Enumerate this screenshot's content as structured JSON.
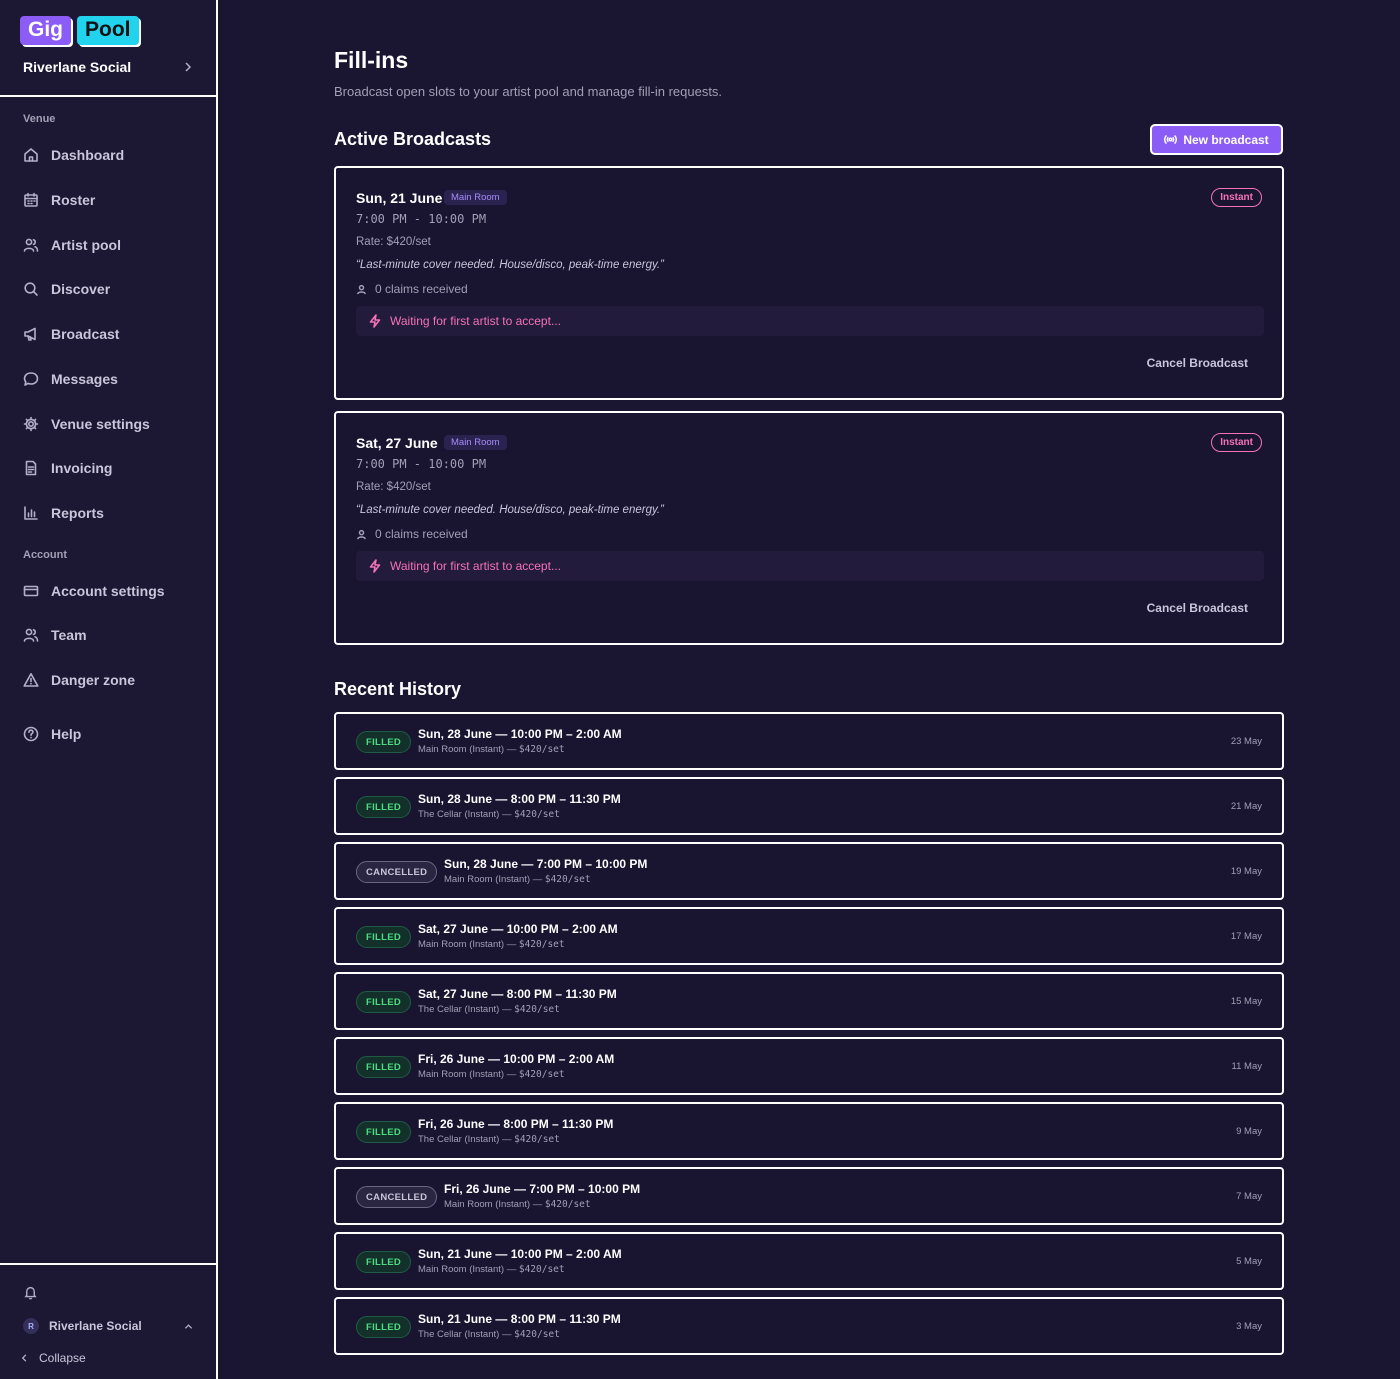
{
  "brand": {
    "part1": "Gig",
    "part2": "Pool",
    "accent": "#8b5cf6",
    "accent2": "#22d3ee"
  },
  "sidebar": {
    "venue_name": "Riverlane Social",
    "sections": [
      {
        "label": "Venue"
      },
      {
        "label": "Account"
      }
    ],
    "items": [
      {
        "label": "Dashboard",
        "icon": "home-icon"
      },
      {
        "label": "Roster",
        "icon": "calendar-icon"
      },
      {
        "label": "Artist pool",
        "icon": "users-icon"
      },
      {
        "label": "Discover",
        "icon": "search-icon"
      },
      {
        "label": "Broadcast",
        "icon": "megaphone-icon"
      },
      {
        "label": "Messages",
        "icon": "message-icon"
      },
      {
        "label": "Venue settings",
        "icon": "gear-icon"
      },
      {
        "label": "Invoicing",
        "icon": "document-icon"
      },
      {
        "label": "Reports",
        "icon": "chart-icon"
      },
      {
        "label": "Account settings",
        "icon": "card-icon"
      },
      {
        "label": "Team",
        "icon": "team-icon"
      },
      {
        "label": "Danger zone",
        "icon": "warning-icon"
      },
      {
        "label": "Help",
        "icon": "help-icon"
      }
    ],
    "footer": {
      "user_name": "Riverlane Social",
      "avatar_initial": "R",
      "collapse_label": "Collapse"
    }
  },
  "page": {
    "title": "Fill-ins",
    "subtitle": "Broadcast open slots to your artist pool and manage fill-in requests."
  },
  "active": {
    "heading": "Active Broadcasts",
    "new_button": "New broadcast",
    "broadcasts": [
      {
        "date": "Sun, 21 June",
        "room": "Main Room",
        "type": "Instant",
        "time": "7:00 PM - 10:00 PM",
        "rate": "Rate: $420/set",
        "note": "“Last-minute cover needed. House/disco, peak-time energy.”",
        "claims": "0 claims received",
        "waiting": "Waiting for first artist to accept...",
        "cancel": "Cancel Broadcast"
      },
      {
        "date": "Sat, 27 June",
        "room": "Main Room",
        "type": "Instant",
        "time": "7:00 PM - 10:00 PM",
        "rate": "Rate: $420/set",
        "note": "“Last-minute cover needed. House/disco, peak-time energy.”",
        "claims": "0 claims received",
        "waiting": "Waiting for first artist to accept...",
        "cancel": "Cancel Broadcast"
      }
    ]
  },
  "history": {
    "heading": "Recent History",
    "rows": [
      {
        "status": "FILLED",
        "title": "Sun, 28 June — 10:00 PM – 2:00 AM",
        "sub_room": "Main Room (Instant) — ",
        "sub_rate": "$420/set",
        "when": "23 May"
      },
      {
        "status": "FILLED",
        "title": "Sun, 28 June — 8:00 PM – 11:30 PM",
        "sub_room": "The Cellar (Instant) — ",
        "sub_rate": "$420/set",
        "when": "21 May"
      },
      {
        "status": "CANCELLED",
        "title": "Sun, 28 June — 7:00 PM – 10:00 PM",
        "sub_room": "Main Room (Instant) — ",
        "sub_rate": "$420/set",
        "when": "19 May"
      },
      {
        "status": "FILLED",
        "title": "Sat, 27 June — 10:00 PM – 2:00 AM",
        "sub_room": "Main Room (Instant) — ",
        "sub_rate": "$420/set",
        "when": "17 May"
      },
      {
        "status": "FILLED",
        "title": "Sat, 27 June — 8:00 PM – 11:30 PM",
        "sub_room": "The Cellar (Instant) — ",
        "sub_rate": "$420/set",
        "when": "15 May"
      },
      {
        "status": "FILLED",
        "title": "Fri, 26 June — 10:00 PM – 2:00 AM",
        "sub_room": "Main Room (Instant) — ",
        "sub_rate": "$420/set",
        "when": "11 May"
      },
      {
        "status": "FILLED",
        "title": "Fri, 26 June — 8:00 PM – 11:30 PM",
        "sub_room": "The Cellar (Instant) — ",
        "sub_rate": "$420/set",
        "when": "9 May"
      },
      {
        "status": "CANCELLED",
        "title": "Fri, 26 June — 7:00 PM – 10:00 PM",
        "sub_room": "Main Room (Instant) — ",
        "sub_rate": "$420/set",
        "when": "7 May"
      },
      {
        "status": "FILLED",
        "title": "Sun, 21 June — 10:00 PM – 2:00 AM",
        "sub_room": "Main Room (Instant) — ",
        "sub_rate": "$420/set",
        "when": "5 May"
      },
      {
        "status": "FILLED",
        "title": "Sun, 21 June — 8:00 PM – 11:30 PM",
        "sub_room": "The Cellar (Instant) — ",
        "sub_rate": "$420/set",
        "when": "3 May"
      }
    ]
  }
}
